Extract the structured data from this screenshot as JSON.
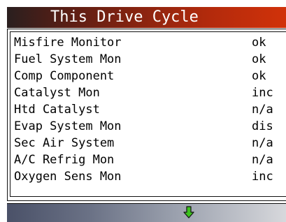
{
  "header": {
    "title": "This Drive Cycle"
  },
  "monitors": [
    {
      "label": "Misfire Monitor",
      "status": "ok"
    },
    {
      "label": "Fuel System Mon",
      "status": "ok"
    },
    {
      "label": "Comp Component",
      "status": "ok"
    },
    {
      "label": "Catalyst Mon",
      "status": "inc"
    },
    {
      "label": "Htd Catalyst",
      "status": "n/a"
    },
    {
      "label": "Evap System Mon",
      "status": "dis"
    },
    {
      "label": "Sec Air System",
      "status": "n/a"
    },
    {
      "label": "A/C Refrig Mon",
      "status": "n/a"
    },
    {
      "label": "Oxygen Sens Mon",
      "status": "inc"
    }
  ],
  "footer": {
    "scroll_icon": "down-arrow-icon",
    "arrow_color": "#3cc21e"
  },
  "colors": {
    "title_bar_start": "#2a1f1f",
    "title_bar_end": "#d1320a",
    "footer_start": "#4a5168",
    "footer_end": "#d7d8dc"
  }
}
